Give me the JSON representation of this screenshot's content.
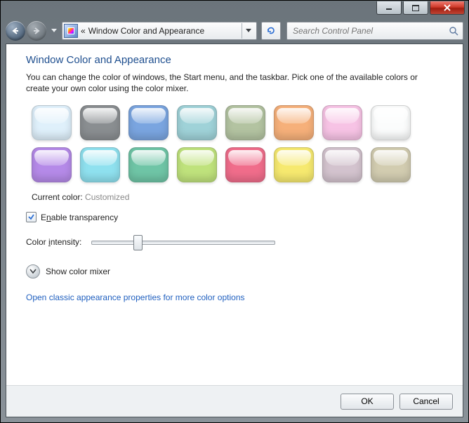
{
  "titlebar": {
    "minimize_name": "minimize",
    "maximize_name": "maximize",
    "close_name": "close"
  },
  "nav": {
    "breadcrumb_prefix": "«",
    "breadcrumb": "Window Color and Appearance",
    "search_placeholder": "Search Control Panel"
  },
  "page": {
    "heading": "Window Color and Appearance",
    "description": "You can change the color of windows, the Start menu, and the taskbar. Pick one of the available colors or create your own color using the color mixer.",
    "current_color_label": "Current color:",
    "current_color_value": "Customized",
    "enable_transparency_label_pre": "E",
    "enable_transparency_label_ul": "n",
    "enable_transparency_label_post": "able transparency",
    "enable_transparency_checked": true,
    "intensity_label_pre": "Color ",
    "intensity_label_ul": "i",
    "intensity_label_post": "ntensity:",
    "show_mixer_label": "Show color mixer",
    "classic_link": "Open classic appearance properties for more color options"
  },
  "swatches": [
    [
      "#dff0fb",
      "#8a8e91",
      "#7aa5e0",
      "#9fd2d8",
      "#b3c3a1",
      "#f6b07a",
      "#f7c3e5",
      "#fbfcfc"
    ],
    [
      "#b58ae8",
      "#8fe1ef",
      "#6fc5a6",
      "#bfe27c",
      "#f06d8b",
      "#f6e96f",
      "#d3c3ce",
      "#d2ccb0"
    ]
  ],
  "footer": {
    "ok": "OK",
    "cancel": "Cancel"
  }
}
